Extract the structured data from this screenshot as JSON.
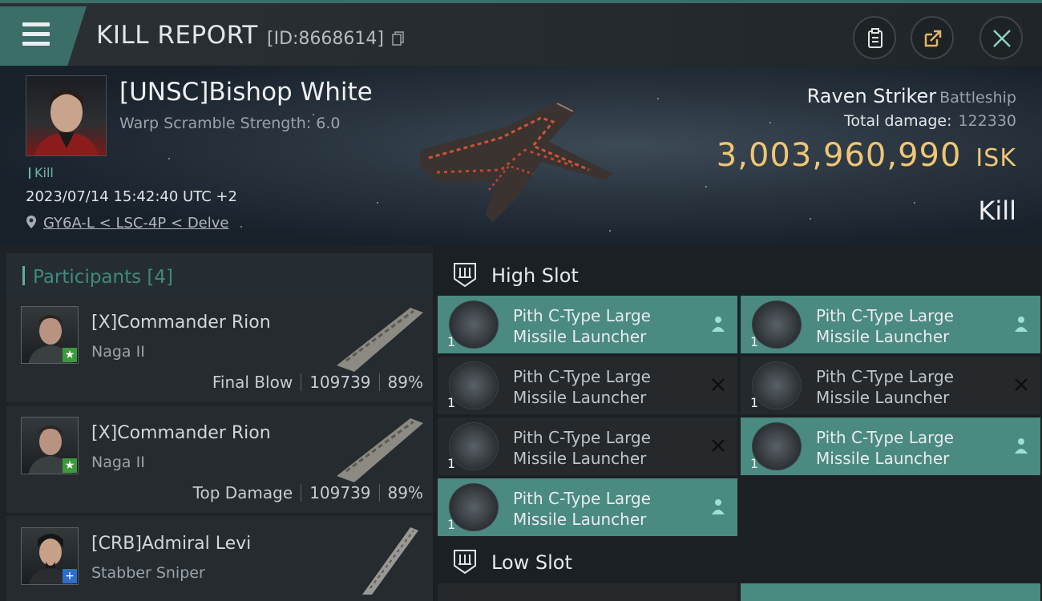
{
  "header": {
    "title": "KILL REPORT",
    "report_id": "[ID:8668614]"
  },
  "victim": {
    "name": "[UNSC]Bishop White",
    "warp_scramble": "Warp Scramble Strength: 6.0",
    "tag": "Kill",
    "datetime": "2023/07/14 15:42:40 UTC +2",
    "location": "GY6A-L < LSC-4P < Delve"
  },
  "ship": {
    "name": "Raven Striker",
    "class": "Battleship",
    "total_damage_label": "Total damage:",
    "total_damage": "122330",
    "isk_value": "3,003,960,990",
    "isk_label": "ISK",
    "result": "Kill"
  },
  "participants": {
    "label": "Participants",
    "count": "[4]",
    "items": [
      {
        "name": "[X]Commander Rion",
        "ship": "Naga II",
        "role": "Final Blow",
        "damage": "109739",
        "percent": "89%",
        "badge": "★"
      },
      {
        "name": "[X]Commander Rion",
        "ship": "Naga II",
        "role": "Top Damage",
        "damage": "109739",
        "percent": "89%",
        "badge": "★"
      },
      {
        "name": "[CRB]Admiral Levi",
        "ship": "Stabber Sniper",
        "badge": "+"
      }
    ]
  },
  "fitting": {
    "high_slot_label": "High Slot",
    "low_slot_label": "Low Slot",
    "high_slots": [
      {
        "line1": "Pith C-Type Large",
        "line2": "Missile Launcher",
        "qty": "1",
        "state": "active"
      },
      {
        "line1": "Pith C-Type Large",
        "line2": "Missile Launcher",
        "qty": "1",
        "state": "active"
      },
      {
        "line1": "Pith C-Type Large",
        "line2": "Missile Launcher",
        "qty": "1",
        "state": "destroyed"
      },
      {
        "line1": "Pith C-Type Large",
        "line2": "Missile Launcher",
        "qty": "1",
        "state": "destroyed"
      },
      {
        "line1": "Pith C-Type Large",
        "line2": "Missile Launcher",
        "qty": "1",
        "state": "destroyed"
      },
      {
        "line1": "Pith C-Type Large",
        "line2": "Missile Launcher",
        "qty": "1",
        "state": "active"
      },
      {
        "line1": "Pith C-Type Large",
        "line2": "Missile Launcher",
        "qty": "1",
        "state": "active"
      }
    ]
  },
  "colors": {
    "accent": "#4a8a80",
    "isk": "#f0c674",
    "badge_green": "#3c9a3c",
    "badge_blue": "#2b6fc8"
  }
}
